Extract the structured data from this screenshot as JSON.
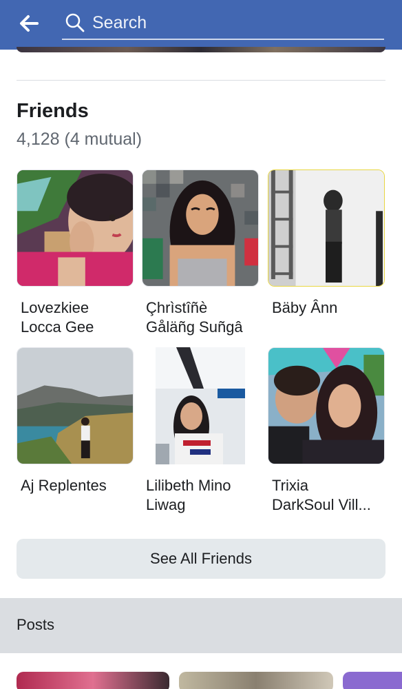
{
  "header": {
    "search_placeholder": "Search"
  },
  "friends": {
    "title": "Friends",
    "count": "4,128 (4 mutual)",
    "items": [
      {
        "line1": "Lovezkiee",
        "line2": "Locca Gee"
      },
      {
        "line1": "Çhrìstîñè",
        "line2": "Gåläñg Suñgâ"
      },
      {
        "line1": "Bäby Ânn",
        "line2": ""
      },
      {
        "line1": "Aj Replentes",
        "line2": ""
      },
      {
        "line1": "Lilibeth Mino",
        "line2": "Liwag"
      },
      {
        "line1": "Trixia",
        "line2": "DarkSoul Vill..."
      }
    ],
    "see_all_label": "See All Friends"
  },
  "posts": {
    "label": "Posts"
  },
  "colors": {
    "header_blue": "#4267b2",
    "button_bg": "#e4e9ec",
    "section_gray": "#dadde1",
    "secondary_text": "#606770"
  }
}
